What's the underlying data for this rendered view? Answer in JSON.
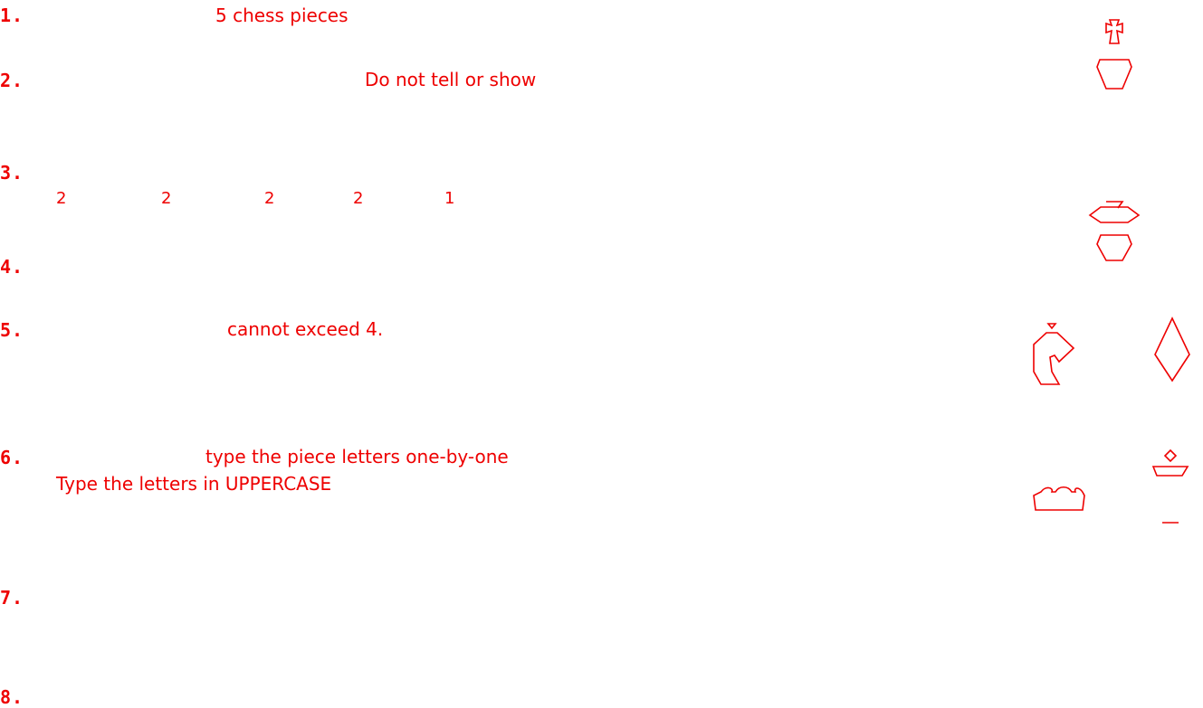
{
  "colors": {
    "primary": "#ee0000",
    "background": "#ffffff"
  },
  "steps": [
    {
      "number": "1."
    },
    {
      "number": "2."
    },
    {
      "number": "3."
    },
    {
      "number": "4."
    },
    {
      "number": "5."
    },
    {
      "number": "6."
    },
    {
      "number": "7."
    },
    {
      "number": "8."
    }
  ],
  "texts": {
    "step1": "5 chess pieces",
    "step2": "Do not tell or show",
    "step5": "cannot exceed 4.",
    "step6_line1": "type the piece letters one-by-one",
    "step6_line2": "Type the letters in UPPERCASE"
  },
  "counts": [
    "2",
    "2",
    "2",
    "2",
    "1"
  ],
  "pieces": [
    {
      "name": "king",
      "icon": "king-icon"
    },
    {
      "name": "bishop",
      "icon": "bishop-icon"
    },
    {
      "name": "knight",
      "icon": "knight-icon"
    },
    {
      "name": "diamond",
      "icon": "diamond-icon"
    },
    {
      "name": "rook",
      "icon": "rook-icon"
    },
    {
      "name": "pawn",
      "icon": "pawn-icon"
    }
  ]
}
